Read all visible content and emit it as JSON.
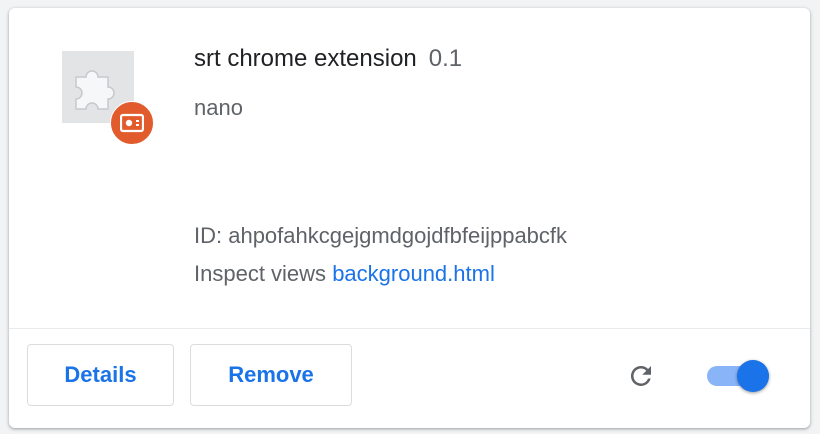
{
  "extension": {
    "name": "srt chrome extension",
    "version": "0.1",
    "description": "nano",
    "id_text": "ID: ahpofahkcgejgmdgojdfbfeijppabcfk",
    "inspect_label": "Inspect views",
    "inspect_link": "background.html",
    "icon": "puzzle-piece-icon",
    "badge_icon": "disk-drive-icon",
    "enabled": true
  },
  "actions": {
    "details_label": "Details",
    "remove_label": "Remove",
    "reload_icon": "reload-icon"
  },
  "colors": {
    "accent": "#1a73e8",
    "toggle_track": "#8ab4f8",
    "badge": "#e25b2c"
  }
}
